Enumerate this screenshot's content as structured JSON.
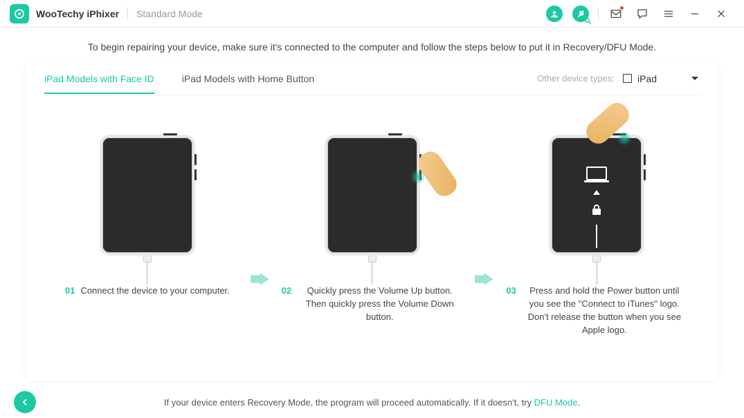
{
  "app": {
    "title": "WooTechy iPhixer",
    "mode": "Standard Mode"
  },
  "instruction": "To begin repairing your device, make sure it's connected to the computer and follow the steps below to put it in Recovery/DFU Mode.",
  "tabs": {
    "faceid": "iPad Models with Face ID",
    "homebtn": "iPad Models with Home Button"
  },
  "device_selector": {
    "label": "Other device types:",
    "value": "iPad"
  },
  "steps": [
    {
      "num": "01",
      "text": "Connect the device to your computer."
    },
    {
      "num": "02",
      "text": "Quickly press the Volume Up button. Then quickly press the Volume Down button."
    },
    {
      "num": "03",
      "text": "Press and hold the Power button until you see the \"Connect to iTunes\" logo. Don't release the button when you see Apple logo."
    }
  ],
  "footer": {
    "text_pre": "If your device enters Recovery Mode, the program will proceed automatically. If it doesn't, try ",
    "link": "DFU Mode",
    "text_post": "."
  }
}
